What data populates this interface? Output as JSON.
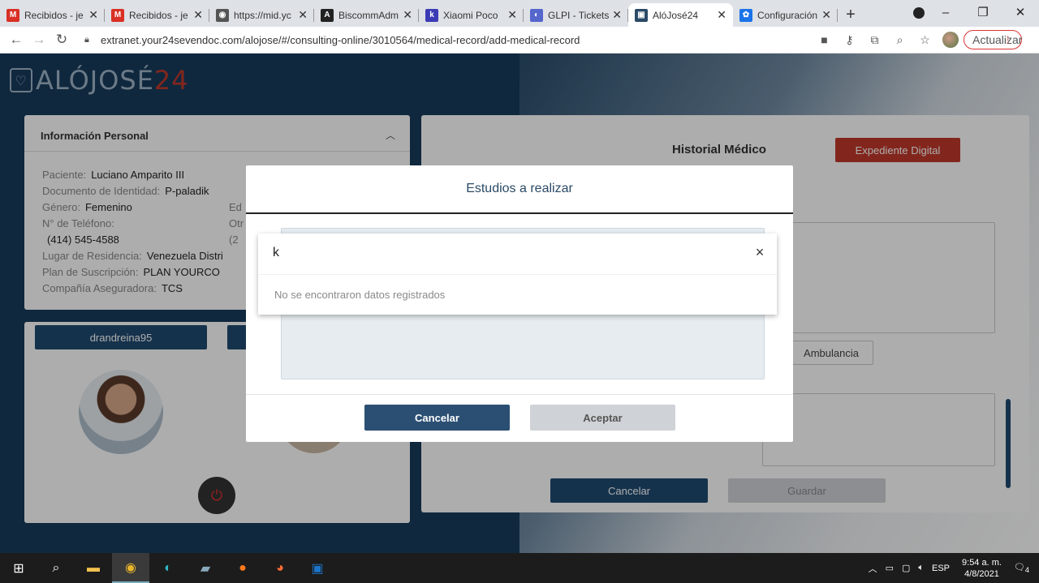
{
  "browser": {
    "tabs": [
      {
        "title": "Recibidos - je",
        "icon": "gmail-icon",
        "color": "#d93025",
        "glyph": "M"
      },
      {
        "title": "Recibidos - je",
        "icon": "gmail-icon",
        "color": "#d93025",
        "glyph": "M"
      },
      {
        "title": "https://mid.yc",
        "icon": "globe-icon",
        "color": "#555555",
        "glyph": "◉"
      },
      {
        "title": "BiscommAdm",
        "icon": "angular-icon",
        "color": "#222222",
        "glyph": "A"
      },
      {
        "title": "Xiaomi Poco",
        "icon": "kr-icon",
        "color": "#3b3bb5",
        "glyph": "k"
      },
      {
        "title": "GLPI - Tickets",
        "icon": "glpi-icon",
        "color": "#5566cc",
        "glyph": "◐"
      },
      {
        "title": "AlóJosé24",
        "icon": "alojose-icon",
        "color": "#2a4a66",
        "glyph": "▣",
        "active": true
      },
      {
        "title": "Configuración",
        "icon": "settings-icon",
        "color": "#1a73e8",
        "glyph": "✿"
      }
    ],
    "new_tab": "+",
    "url": "extranet.your24sevendoc.com/alojose/#/consulting-online/3010564/medical-record/add-medical-record",
    "update_label": "Actualizar"
  },
  "logo": {
    "main": "ALÓJOSÉ",
    "accent": "24"
  },
  "personal_info": {
    "title": "Información Personal",
    "fields": [
      {
        "label": "Paciente:",
        "value": "Luciano Amparito III"
      },
      {
        "label": "Documento de Identidad:",
        "value": "P-paladik"
      },
      {
        "label": "Género:",
        "value": "Femenino",
        "label2": "Ed"
      },
      {
        "label": "N° de Teléfono:",
        "value": "",
        "label2": "Otr"
      },
      {
        "label": "",
        "value": "(414) 545-4588",
        "label2": "(2"
      },
      {
        "label": "Lugar de Residencia:",
        "value": "Venezuela Distri"
      },
      {
        "label": "Plan de Suscripción:",
        "value": "PLAN YOURCO"
      },
      {
        "label": "Compañía Aseguradora:",
        "value": "TCS"
      }
    ]
  },
  "doctor": {
    "username": "drandreina95"
  },
  "historial": {
    "title": "Historial Médico",
    "expediente_label": "Expediente Digital",
    "ambulancia_label": "Ambulancia",
    "cancel_label": "Cancelar",
    "save_label": "Guardar"
  },
  "modal": {
    "title": "Estudios a realizar",
    "search_value": "k",
    "empty_text": "No se encontraron datos registrados",
    "clear_symbol": "×",
    "cancel_label": "Cancelar",
    "accept_label": "Aceptar"
  },
  "taskbar": {
    "lang": "ESP",
    "time": "9:54 a. m.",
    "date": "4/8/2021",
    "notifications": "4"
  },
  "colors": {
    "primary": "#1f4a70",
    "danger": "#c0392b",
    "disabled": "#cfd2d6"
  }
}
